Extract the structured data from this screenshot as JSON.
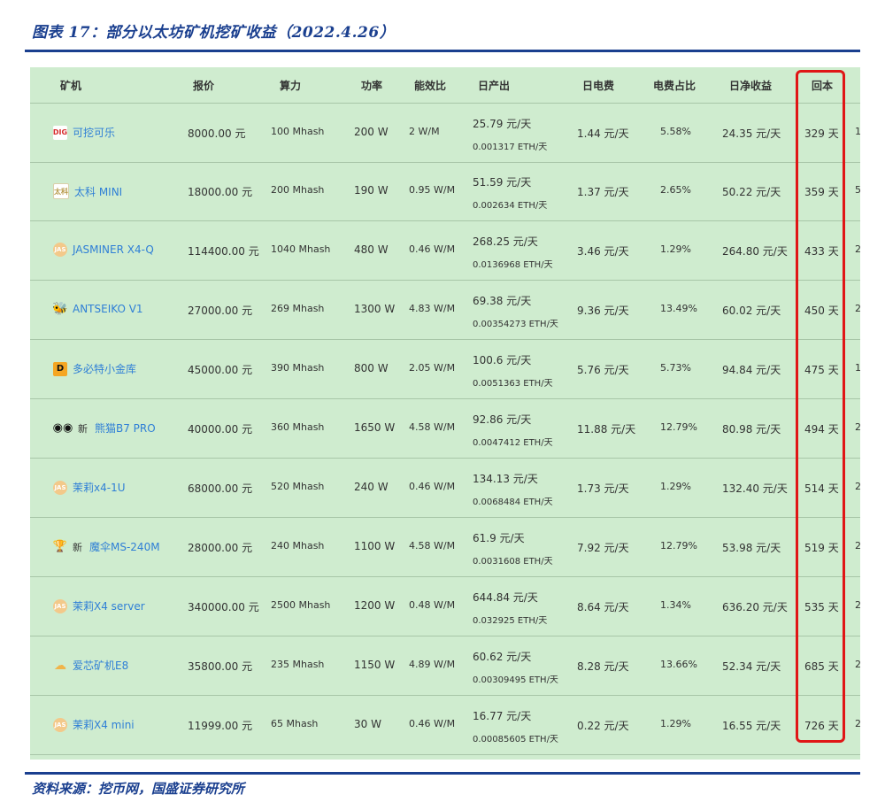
{
  "figure": {
    "title": "图表 17：部分以太坊矿机挖矿收益（2022.4.26）",
    "source": "资料来源：挖币网，国盛证券研究所"
  },
  "colors": {
    "brand_blue": "#1a3f8f",
    "panel_green": "#cfeccf",
    "link_blue": "#2f7fd6",
    "highlight_red": "#e01616"
  },
  "table": {
    "headers": {
      "miner": "矿机",
      "price": "报价",
      "hashrate": "算力",
      "power": "功率",
      "efficiency": "能效比",
      "daily_output": "日产出",
      "daily_electricity": "日电费",
      "electricity_share": "电费占比",
      "daily_net": "日净收益",
      "payback": "回本"
    },
    "rows": [
      {
        "logo_icon": "dig-logo-icon",
        "logo_text": "DIG",
        "new_badge": "",
        "name": "可挖可乐",
        "price": "8000.00 元",
        "hashrate": "100 Mhash",
        "power": "200 W",
        "efficiency": "2 W/M",
        "output_cny": "25.79 元/天",
        "output_eth": "0.001317 ETH/天",
        "electricity": "1.44 元/天",
        "share": "5.58%",
        "net": "24.35 元/天",
        "payback": "329 天",
        "edge": "1"
      },
      {
        "logo_icon": "taike-logo-icon",
        "logo_text": "太科",
        "new_badge": "",
        "name": "太科 MINI",
        "price": "18000.00 元",
        "hashrate": "200 Mhash",
        "power": "190 W",
        "efficiency": "0.95 W/M",
        "output_cny": "51.59 元/天",
        "output_eth": "0.002634 ETH/天",
        "electricity": "1.37 元/天",
        "share": "2.65%",
        "net": "50.22 元/天",
        "payback": "359 天",
        "edge": "5"
      },
      {
        "logo_icon": "jas-logo-icon",
        "logo_text": "JAS",
        "new_badge": "",
        "name": "JASMINER X4-Q",
        "price": "114400.00 元",
        "hashrate": "1040 Mhash",
        "power": "480 W",
        "efficiency": "0.46 W/M",
        "output_cny": "268.25 元/天",
        "output_eth": "0.0136968 ETH/天",
        "electricity": "3.46 元/天",
        "share": "1.29%",
        "net": "264.80 元/天",
        "payback": "433 天",
        "edge": "2"
      },
      {
        "logo_icon": "antseiko-logo-icon",
        "logo_text": "🐝",
        "new_badge": "",
        "name": "ANTSEIKO V1",
        "price": "27000.00 元",
        "hashrate": "269 Mhash",
        "power": "1300 W",
        "efficiency": "4.83 W/M",
        "output_cny": "69.38 元/天",
        "output_eth": "0.00354273 ETH/天",
        "electricity": "9.36 元/天",
        "share": "13.49%",
        "net": "60.02 元/天",
        "payback": "450 天",
        "edge": "2"
      },
      {
        "logo_icon": "duobite-logo-icon",
        "logo_text": "D",
        "new_badge": "",
        "name": "多必特小金库",
        "price": "45000.00 元",
        "hashrate": "390 Mhash",
        "power": "800 W",
        "efficiency": "2.05 W/M",
        "output_cny": "100.6 元/天",
        "output_eth": "0.0051363 ETH/天",
        "electricity": "5.76 元/天",
        "share": "5.73%",
        "net": "94.84 元/天",
        "payback": "475 天",
        "edge": "1"
      },
      {
        "logo_icon": "panda-logo-icon",
        "logo_text": "◉◉",
        "new_badge": "新",
        "name": "熊猫B7 PRO",
        "price": "40000.00 元",
        "hashrate": "360 Mhash",
        "power": "1650 W",
        "efficiency": "4.58 W/M",
        "output_cny": "92.86 元/天",
        "output_eth": "0.0047412 ETH/天",
        "electricity": "11.88 元/天",
        "share": "12.79%",
        "net": "80.98 元/天",
        "payback": "494 天",
        "edge": "2"
      },
      {
        "logo_icon": "jas-logo-icon",
        "logo_text": "JAS",
        "new_badge": "",
        "name": "茉莉x4-1U",
        "price": "68000.00 元",
        "hashrate": "520 Mhash",
        "power": "240 W",
        "efficiency": "0.46 W/M",
        "output_cny": "134.13 元/天",
        "output_eth": "0.0068484 ETH/天",
        "electricity": "1.73 元/天",
        "share": "1.29%",
        "net": "132.40 元/天",
        "payback": "514 天",
        "edge": "2"
      },
      {
        "logo_icon": "trophy-logo-icon",
        "logo_text": "🏆",
        "new_badge": "新",
        "name": "魔伞MS-240M",
        "price": "28000.00 元",
        "hashrate": "240 Mhash",
        "power": "1100 W",
        "efficiency": "4.58 W/M",
        "output_cny": "61.9 元/天",
        "output_eth": "0.0031608 ETH/天",
        "electricity": "7.92 元/天",
        "share": "12.79%",
        "net": "53.98 元/天",
        "payback": "519 天",
        "edge": "2"
      },
      {
        "logo_icon": "jas-logo-icon",
        "logo_text": "JAS",
        "new_badge": "",
        "name": "茉莉X4 server",
        "price": "340000.00 元",
        "hashrate": "2500 Mhash",
        "power": "1200 W",
        "efficiency": "0.48 W/M",
        "output_cny": "644.84 元/天",
        "output_eth": "0.032925 ETH/天",
        "electricity": "8.64 元/天",
        "share": "1.34%",
        "net": "636.20 元/天",
        "payback": "535 天",
        "edge": "2"
      },
      {
        "logo_icon": "aixin-logo-icon",
        "logo_text": "☁",
        "new_badge": "",
        "name": "爱芯矿机E8",
        "price": "35800.00 元",
        "hashrate": "235 Mhash",
        "power": "1150 W",
        "efficiency": "4.89 W/M",
        "output_cny": "60.62 元/天",
        "output_eth": "0.00309495 ETH/天",
        "electricity": "8.28 元/天",
        "share": "13.66%",
        "net": "52.34 元/天",
        "payback": "685 天",
        "edge": "2"
      },
      {
        "logo_icon": "jas-logo-icon",
        "logo_text": "JAS",
        "new_badge": "",
        "name": "茉莉X4 mini",
        "price": "11999.00 元",
        "hashrate": "65 Mhash",
        "power": "30 W",
        "efficiency": "0.46 W/M",
        "output_cny": "16.77 元/天",
        "output_eth": "0.00085605 ETH/天",
        "electricity": "0.22 元/天",
        "share": "1.29%",
        "net": "16.55 元/天",
        "payback": "726 天",
        "edge": "2"
      }
    ]
  }
}
